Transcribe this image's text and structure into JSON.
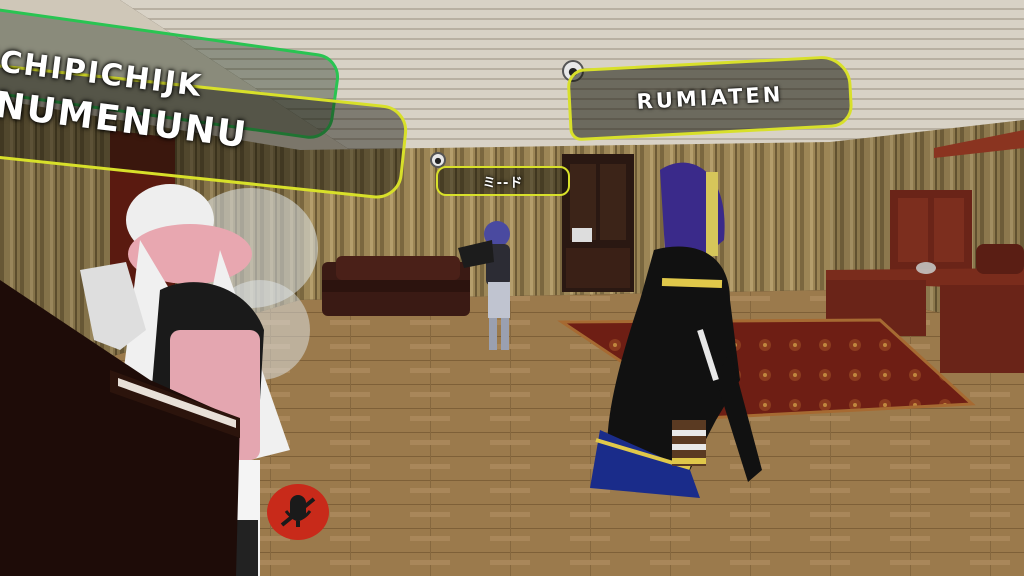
{
  "scene": {
    "name": "VR hangout room",
    "colors": {
      "wall": "#a08a5c",
      "floor": "#9a7a4e",
      "ceiling": "#d8d2c6",
      "nameplate_border": "#d8e02a",
      "nameplate_border_alt": "#29c452",
      "mute_button": "#c82a1a"
    }
  },
  "nameplates": {
    "rumia": {
      "label": "RUMIATEN",
      "icon": "user-icon"
    },
    "mido": {
      "label": "ミ--ド",
      "icon": "user-icon"
    },
    "near_line1": "ICHIPICHIJK",
    "near_line2": "NUMENUNU"
  },
  "hud": {
    "mute": {
      "icon": "mic-muted-icon",
      "state": "muted"
    }
  }
}
